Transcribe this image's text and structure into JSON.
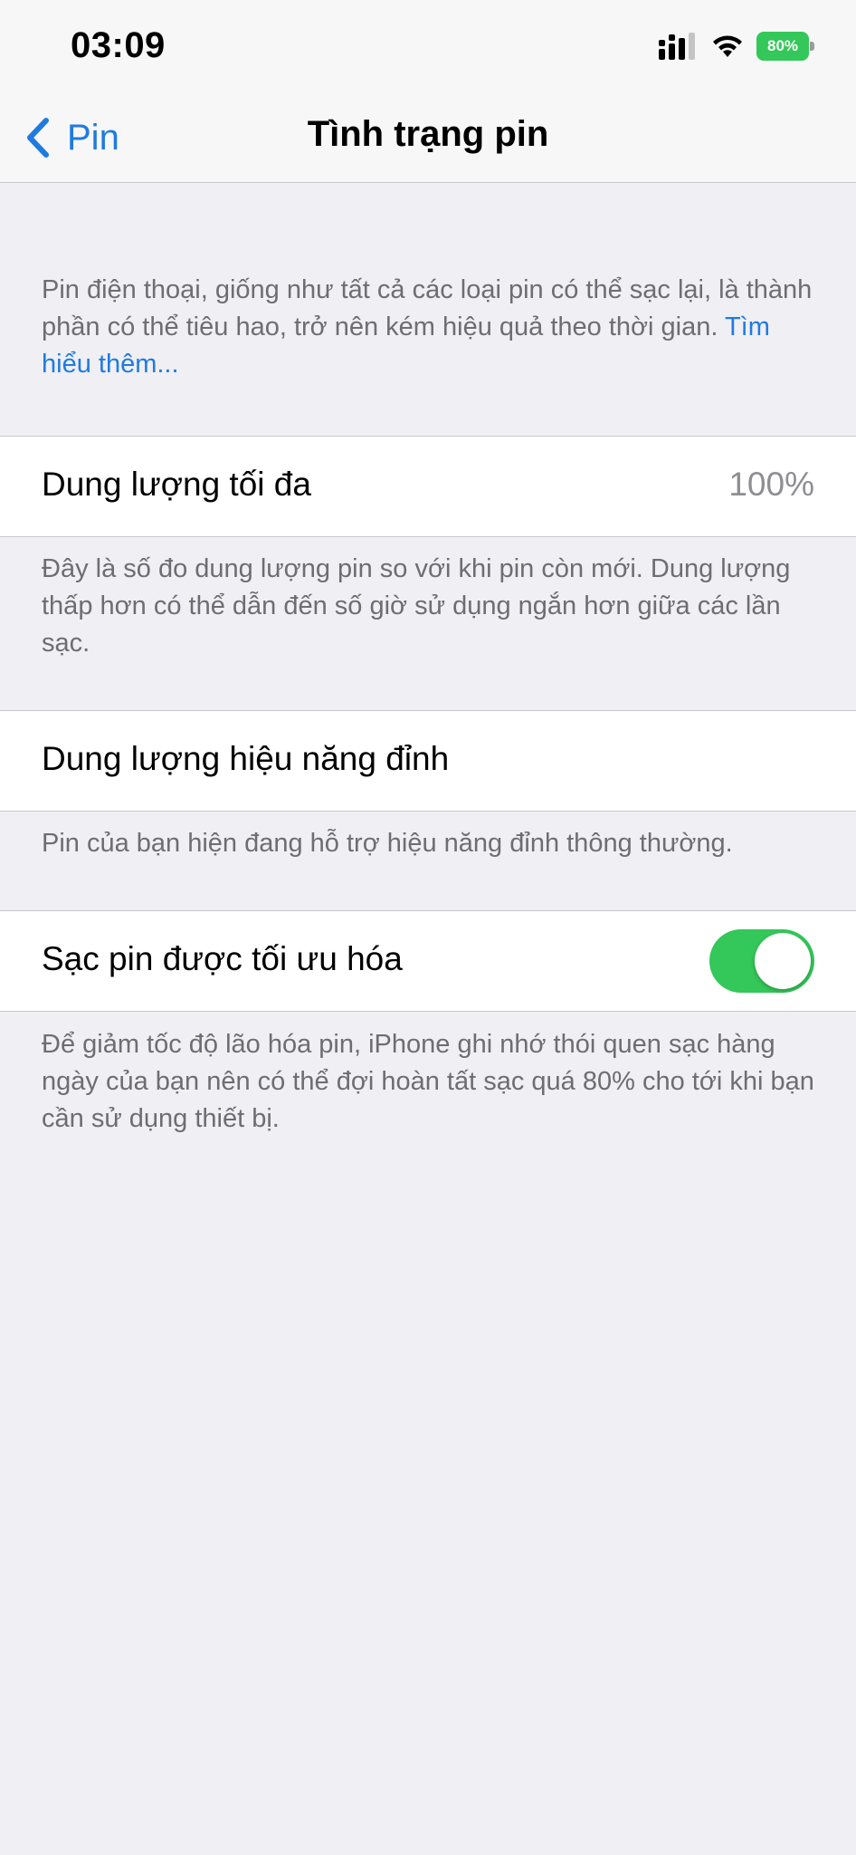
{
  "status_bar": {
    "time": "03:09",
    "battery_percent": "80%",
    "battery_color": "#34c759",
    "icons": [
      "cellular-signal-icon",
      "wifi-icon",
      "battery-icon"
    ]
  },
  "nav": {
    "back_label": "Pin",
    "title": "Tình trạng pin",
    "accent_color": "#1f7be0"
  },
  "intro": {
    "text": "Pin điện thoại, giống như tất cả các loại pin có thể sạc lại, là thành phần có thể tiêu hao, trở nên kém hiệu quả theo thời gian. ",
    "link": "Tìm hiểu thêm..."
  },
  "max_capacity": {
    "label": "Dung lượng tối đa",
    "value": "100%",
    "footer": "Đây là số đo dung lượng pin so với khi pin còn mới. Dung lượng thấp hơn có thể dẫn đến số giờ sử dụng ngắn hơn giữa các lần sạc."
  },
  "peak_performance": {
    "label": "Dung lượng hiệu năng đỉnh",
    "footer": "Pin của bạn hiện đang hỗ trợ hiệu năng đỉnh thông thường."
  },
  "optimized_charging": {
    "label": "Sạc pin được tối ưu hóa",
    "enabled": true,
    "footer": "Để giảm tốc độ lão hóa pin, iPhone ghi nhớ thói quen sạc hàng ngày của bạn nên có thể đợi hoàn tất sạc quá 80% cho tới khi bạn cần sử dụng thiết bị."
  }
}
